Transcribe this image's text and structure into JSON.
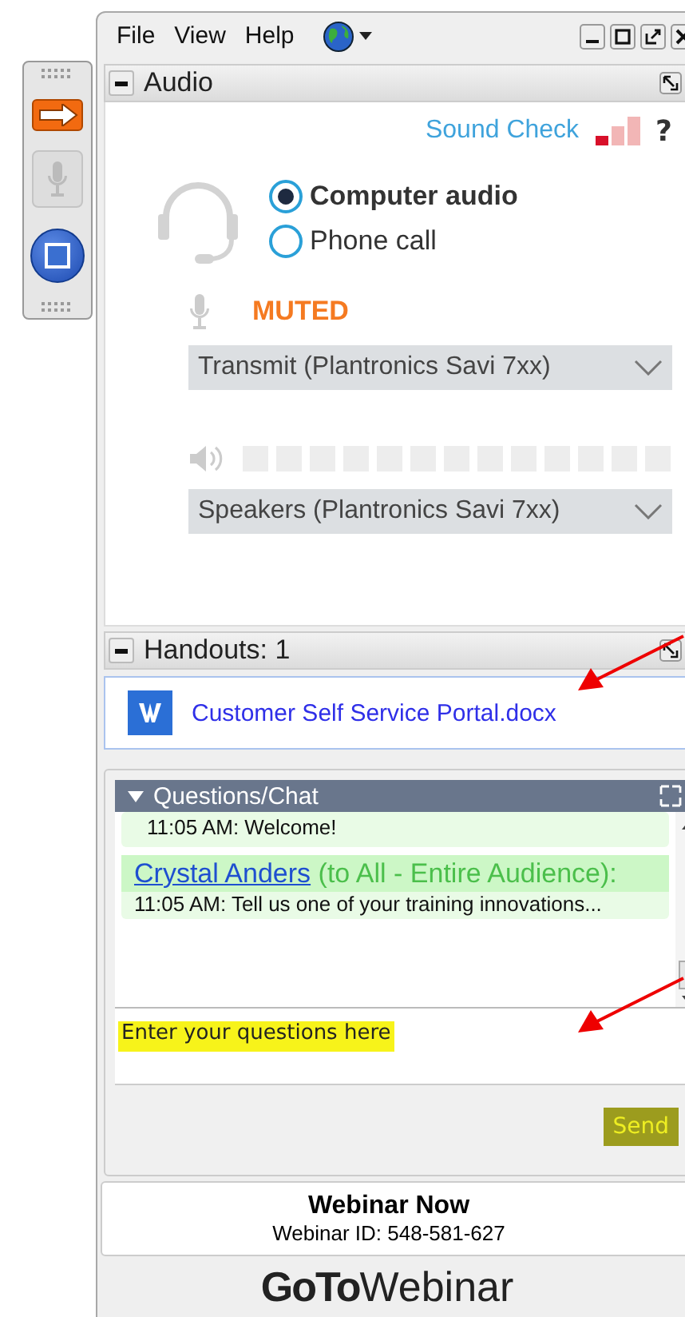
{
  "toolbar": {
    "buttons": [
      {
        "kind": "arrow",
        "disabled": false
      },
      {
        "kind": "mic",
        "disabled": true
      },
      {
        "kind": "screen",
        "disabled": false
      }
    ]
  },
  "menu": [
    "File",
    "View",
    "Help"
  ],
  "audio": {
    "title": "Audio",
    "sound_check": "Sound Check",
    "sound_meter": {
      "level": 0.33
    },
    "help": "?",
    "options": [
      {
        "label": "Computer audio",
        "selected": true
      },
      {
        "label": "Phone call",
        "selected": false
      }
    ],
    "mic_status": "MUTED",
    "transmit": "Transmit (Plantronics Savi 7xx)",
    "speaker_meter": {
      "level": 0
    },
    "speakers": "Speakers (Plantronics Savi 7xx)"
  },
  "handouts": {
    "title": "Handouts: 1",
    "files": [
      {
        "name": "Customer Self Service Portal.docx"
      }
    ]
  },
  "chat": {
    "title": "Questions/Chat",
    "messages": [
      {
        "text": "11:05 AM: Welcome!"
      },
      {
        "sender": "Crystal Anders",
        "audience": "(to All - Entire Audience):",
        "text": "11:05 AM: Tell us one of your training innovations..."
      }
    ],
    "input": {
      "placeholder": "Enter your questions here"
    },
    "send": "Send"
  },
  "footer": {
    "title": "Webinar Now",
    "webinar_id": "Webinar ID: 548-581-627"
  },
  "logo": {
    "bold": "GoTo",
    "light": "Webinar"
  }
}
